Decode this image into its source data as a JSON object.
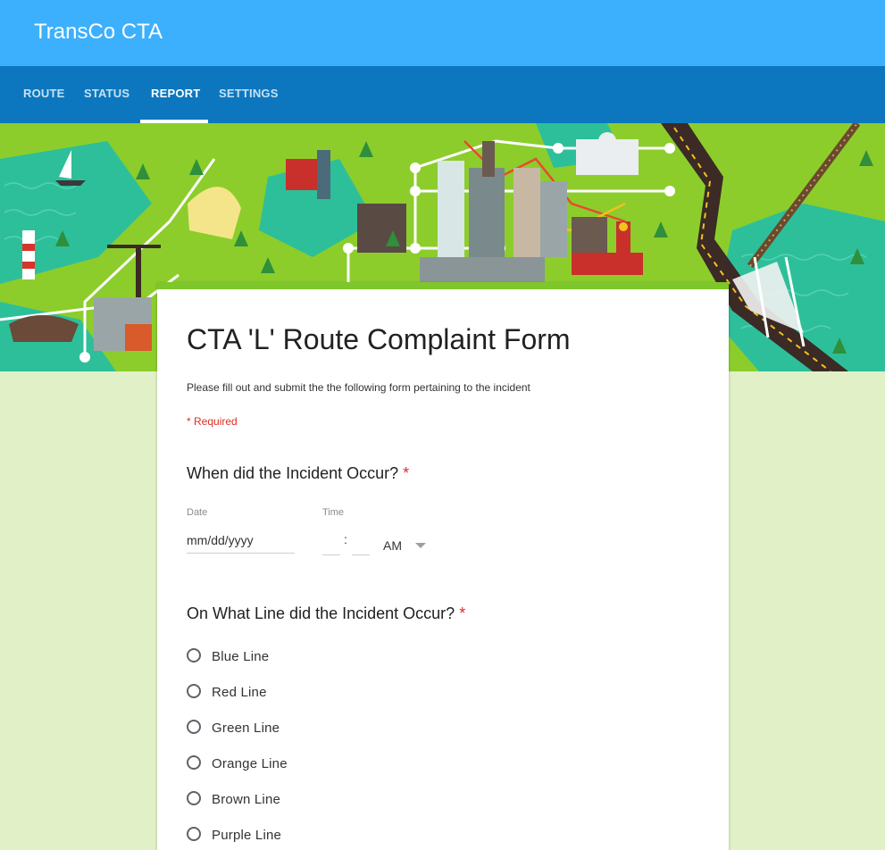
{
  "app": {
    "title": "TransCo CTA"
  },
  "tabs": [
    {
      "label": "ROUTE"
    },
    {
      "label": "STATUS"
    },
    {
      "label": "REPORT"
    },
    {
      "label": "SETTINGS"
    }
  ],
  "active_tab": "REPORT",
  "colors": {
    "app_bar": "#3cb0fd",
    "tab_bar": "#0c77be",
    "page_background": "#e1f0c7",
    "card_accent": "#7dc72b",
    "required": "#d93025"
  },
  "form": {
    "title": "CTA 'L' Route Complaint Form",
    "description": "Please fill out and submit the the following form pertaining to the incident",
    "required_note": "* Required",
    "q1": {
      "text": "When did the Incident Occur?",
      "required_mark": "*",
      "date_label": "Date",
      "date_value": "mm/dd/yyyy",
      "time_label": "Time",
      "time_separator": ":",
      "ampm_value": "AM"
    },
    "q2": {
      "text": "On What Line did the Incident Occur?",
      "required_mark": "*",
      "options": [
        {
          "label": "Blue Line"
        },
        {
          "label": "Red Line"
        },
        {
          "label": "Green Line"
        },
        {
          "label": "Orange Line"
        },
        {
          "label": "Brown Line"
        },
        {
          "label": "Purple Line"
        }
      ]
    }
  }
}
